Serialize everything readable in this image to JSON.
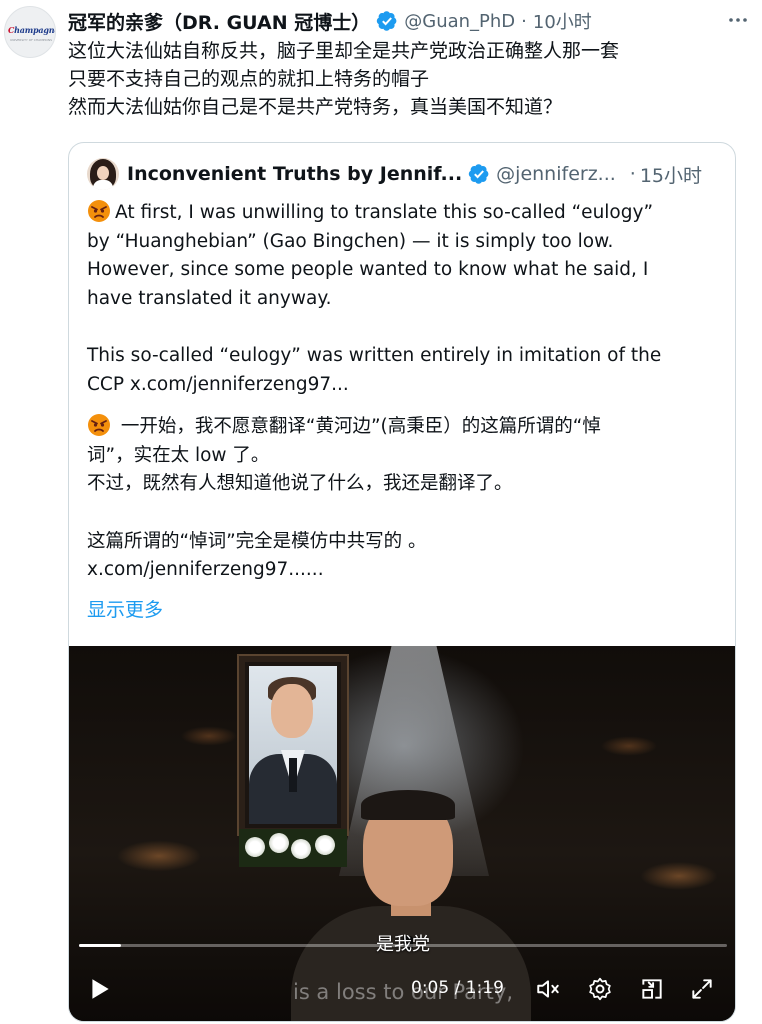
{
  "tweet": {
    "author_name": "冠军的亲爹（DR. GUAN 冠博士）",
    "handle": "@Guan_PhD",
    "separator": "·",
    "time": "10小时",
    "avatar_logo_text": "Champagne",
    "avatar_logo_sub": "UNIVERSITY OF CHAMPIONS",
    "lines": [
      "这位大法仙姑自称反共，脑子里却全是共产党政治正确整人那一套",
      "只要不支持自己的观点的就扣上特务的帽子",
      "然而大法仙姑你自己是不是共产党特务，真当美国不知道？"
    ]
  },
  "quote": {
    "author_name": "Inconvenient Truths by Jennif...",
    "handle": "@jenniferz...",
    "separator": "·",
    "time": "15小时",
    "en_lines": [
      "At first, I was unwilling to translate this so-called “eulogy”",
      "by “Huanghebian” (Gao Bingchen) — it is simply too low.",
      "However, since some people wanted to know what he said, I",
      "have translated it anyway."
    ],
    "en_lines_2": [
      "This so-called “eulogy” was written entirely in imitation of the",
      "CCP  x.com/jenniferzeng97..."
    ],
    "cn_lines": [
      " 一开始，我不愿意翻译“黄河边”(高秉臣）的这篇所谓的“悼",
      "词”，实在太 low 了。",
      "不过，既然有人想知道他说了什么，我还是翻译了。"
    ],
    "cn_lines_2": [
      "这篇所谓的“悼词”完全是模仿中共写的 。",
      "x.com/jenniferzeng97......"
    ],
    "show_more": "显示更多"
  },
  "video": {
    "subtitle_cn": "是我党",
    "subtitle_en": "is a loss to our Party,",
    "time_readout": "0:05 / 1:19",
    "progress": 0.065
  },
  "colors": {
    "link": "#1d9bf0",
    "verified": "#1d9bf0",
    "secondary_text": "#536471"
  },
  "icons": [
    "verified-badge-icon",
    "more-icon",
    "angry-face-icon",
    "play-icon",
    "mute-icon",
    "settings-gear-icon",
    "picture-in-picture-icon",
    "fullscreen-icon"
  ]
}
